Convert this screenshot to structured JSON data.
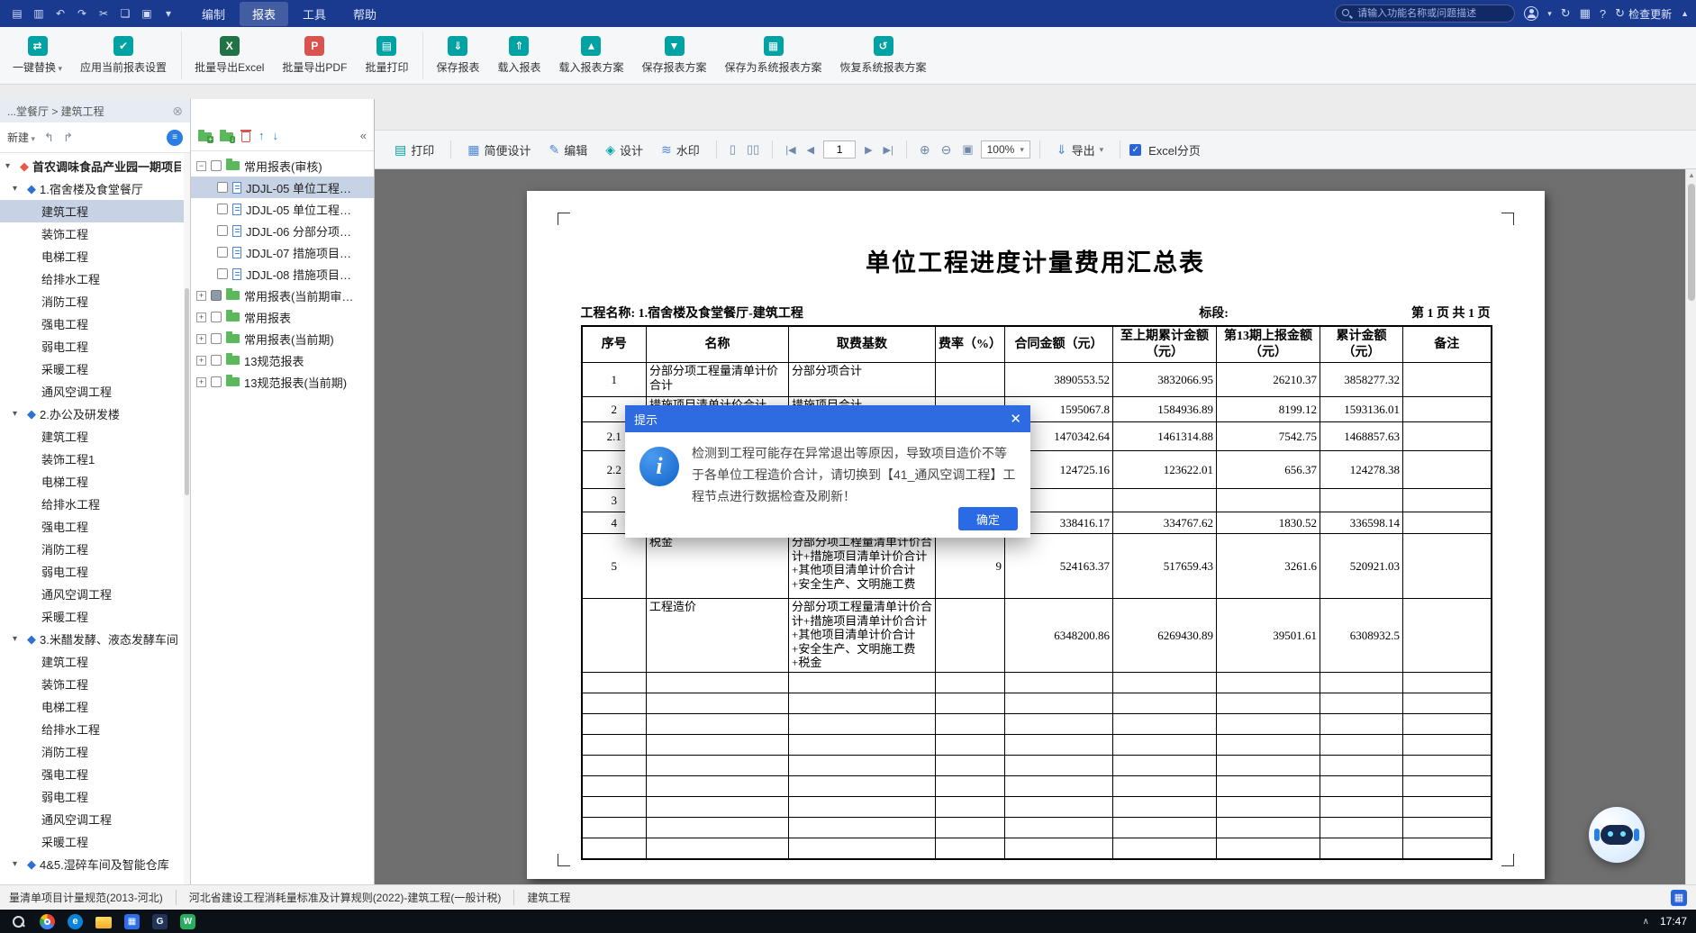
{
  "menubar": {
    "quick_icons": [
      {
        "name": "app-menu-icon",
        "glyph": "▤"
      },
      {
        "name": "save-icon",
        "glyph": "▥"
      },
      {
        "name": "undo-icon",
        "glyph": "↶"
      },
      {
        "name": "redo-icon",
        "glyph": "↷"
      },
      {
        "name": "cut-icon",
        "glyph": "✂"
      },
      {
        "name": "copy-icon",
        "glyph": "❏"
      },
      {
        "name": "paste-icon",
        "glyph": "▣"
      },
      {
        "name": "more-dropdown-icon",
        "glyph": "▾"
      }
    ],
    "menus": [
      {
        "label": "编制"
      },
      {
        "label": "报表",
        "active": true
      },
      {
        "label": "工具"
      },
      {
        "label": "帮助"
      }
    ],
    "search_placeholder": "请输入功能名称或问题描述",
    "check_update_label": "检查更新"
  },
  "ribbon": {
    "buttons": [
      {
        "label": "一键替换",
        "icon": "batch-replace-icon",
        "glyph": "⇄",
        "color": "#00a2a4",
        "dropdown": true
      },
      {
        "label": "应用当前报表设置",
        "icon": "apply-report-settings-icon",
        "glyph": "✔",
        "color": "#00a2a4"
      },
      {
        "label": "批量导出Excel",
        "icon": "batch-export-excel-icon",
        "glyph": "X",
        "color": "#217346",
        "group": "g2"
      },
      {
        "label": "批量导出PDF",
        "icon": "batch-export-pdf-icon",
        "glyph": "P",
        "color": "#d9534f"
      },
      {
        "label": "批量打印",
        "icon": "batch-print-icon",
        "glyph": "▤",
        "color": "#00a2a4"
      },
      {
        "label": "保存报表",
        "icon": "save-report-icon",
        "glyph": "⇓",
        "color": "#00a2a4",
        "group": "g3"
      },
      {
        "label": "载入报表",
        "icon": "load-report-icon",
        "glyph": "⇑",
        "color": "#00a2a4"
      },
      {
        "label": "载入报表方案",
        "icon": "load-report-scheme-icon",
        "glyph": "▲",
        "color": "#00a2a4"
      },
      {
        "label": "保存报表方案",
        "icon": "save-report-scheme-icon",
        "glyph": "▼",
        "color": "#00a2a4"
      },
      {
        "label": "保存为系统报表方案",
        "icon": "save-as-system-scheme-icon",
        "glyph": "▦",
        "color": "#00a2a4"
      },
      {
        "label": "恢复系统报表方案",
        "icon": "restore-system-scheme-icon",
        "glyph": "↺",
        "color": "#00a2a4"
      }
    ]
  },
  "left_panel": {
    "breadcrumb": "...堂餐厅 > 建筑工程",
    "new_button": "新建",
    "tree": [
      {
        "label": "首农调味食品产业园一期项目",
        "level": 0,
        "icon": "project-icon"
      },
      {
        "label": "1.宿舍楼及食堂餐厅",
        "level": 1,
        "icon": "building-icon"
      },
      {
        "label": "建筑工程",
        "level": 2,
        "selected": true
      },
      {
        "label": "装饰工程",
        "level": 2
      },
      {
        "label": "电梯工程",
        "level": 2
      },
      {
        "label": "给排水工程",
        "level": 2
      },
      {
        "label": "消防工程",
        "level": 2
      },
      {
        "label": "强电工程",
        "level": 2
      },
      {
        "label": "弱电工程",
        "level": 2
      },
      {
        "label": "采暖工程",
        "level": 2
      },
      {
        "label": "通风空调工程",
        "level": 2
      },
      {
        "label": "2.办公及研发楼",
        "level": 1,
        "icon": "building-icon"
      },
      {
        "label": "建筑工程",
        "level": 2
      },
      {
        "label": "装饰工程1",
        "level": 2
      },
      {
        "label": "电梯工程",
        "level": 2
      },
      {
        "label": "给排水工程",
        "level": 2
      },
      {
        "label": "强电工程",
        "level": 2
      },
      {
        "label": "消防工程",
        "level": 2
      },
      {
        "label": "弱电工程",
        "level": 2
      },
      {
        "label": "通风空调工程",
        "level": 2
      },
      {
        "label": "采暖工程",
        "level": 2
      },
      {
        "label": "3.米醋发酵、液态发酵车间",
        "level": 1,
        "icon": "building-icon"
      },
      {
        "label": "建筑工程",
        "level": 2
      },
      {
        "label": "装饰工程",
        "level": 2
      },
      {
        "label": "电梯工程",
        "level": 2
      },
      {
        "label": "给排水工程",
        "level": 2
      },
      {
        "label": "消防工程",
        "level": 2
      },
      {
        "label": "强电工程",
        "level": 2
      },
      {
        "label": "弱电工程",
        "level": 2
      },
      {
        "label": "通风空调工程",
        "level": 2
      },
      {
        "label": "采暖工程",
        "level": 2
      },
      {
        "label": "4&5.湿碎车间及智能仓库",
        "level": 1,
        "icon": "building-icon"
      }
    ]
  },
  "middle_panel": {
    "tree": [
      {
        "label": "常用报表(审核)",
        "icon": "folder-icon",
        "checkbox": "empty",
        "expander": "minus"
      },
      {
        "label": "JDJL-05 单位工程…",
        "icon": "report-icon",
        "checkbox": "empty",
        "child": true,
        "selected": true
      },
      {
        "label": "JDJL-05 单位工程…",
        "icon": "report-icon",
        "checkbox": "empty",
        "child": true
      },
      {
        "label": "JDJL-06 分部分项…",
        "icon": "report-icon",
        "checkbox": "empty",
        "child": true
      },
      {
        "label": "JDJL-07 措施项目…",
        "icon": "report-icon",
        "checkbox": "empty",
        "child": true
      },
      {
        "label": "JDJL-08 措施项目…",
        "icon": "report-icon",
        "checkbox": "empty",
        "child": true
      },
      {
        "label": "常用报表(当前期审…",
        "icon": "folder-icon",
        "checkbox": "filled",
        "expander": "plus"
      },
      {
        "label": "常用报表",
        "icon": "folder-icon",
        "checkbox": "empty",
        "expander": "plus"
      },
      {
        "label": "常用报表(当前期)",
        "icon": "folder-icon",
        "checkbox": "empty",
        "expander": "plus"
      },
      {
        "label": "13规范报表",
        "icon": "folder-icon",
        "checkbox": "empty",
        "expander": "plus"
      },
      {
        "label": "13规范报表(当前期)",
        "icon": "folder-icon",
        "checkbox": "empty",
        "expander": "plus"
      }
    ]
  },
  "preview": {
    "print": "打印",
    "simple_design": "简便设计",
    "edit": "编辑",
    "design": "设计",
    "watermark": "水印",
    "page_value": "1",
    "zoom_value": "100%",
    "export": "导出",
    "excel_paging": "Excel分页"
  },
  "report": {
    "title": "单位工程进度计量费用汇总表",
    "project_label": "工程名称: 1.宿舍楼及食堂餐厅-建筑工程",
    "section_label": "标段:",
    "page_label": "第 1 页 共 1 页",
    "columns": [
      "序号",
      "名称",
      "取费基数",
      "费率（%）",
      "合同金额（元）",
      "至上期累计金额（元）",
      "第13期上报金额（元）",
      "累计金额（元）",
      "备注"
    ],
    "rows": [
      {
        "xh": "1",
        "mc": "分部分项工程量清单计价合计",
        "qf": "分部分项合计",
        "fl": "",
        "ht": "3890553.52",
        "sq": "3832066.95",
        "bq": "26210.37",
        "lj": "3858277.32",
        "bz": ""
      },
      {
        "xh": "2",
        "mc": "措施项目清单计价合计",
        "qf": "措施项目合计",
        "fl": "",
        "ht": "1595067.8",
        "sq": "1584936.89",
        "bq": "8199.12",
        "lj": "1593136.01",
        "bz": ""
      },
      {
        "xh": "2.1",
        "mc": "",
        "qf": "",
        "fl": "",
        "ht": "1470342.64",
        "sq": "1461314.88",
        "bq": "7542.75",
        "lj": "1468857.63",
        "bz": ""
      },
      {
        "xh": "2.2",
        "mc": "",
        "qf": "",
        "fl": "",
        "ht": "124725.16",
        "sq": "123622.01",
        "bq": "656.37",
        "lj": "124278.38",
        "bz": ""
      },
      {
        "xh": "3",
        "mc": "",
        "qf": "",
        "fl": "",
        "ht": "",
        "sq": "",
        "bq": "",
        "lj": "",
        "bz": ""
      },
      {
        "xh": "4",
        "mc": "",
        "qf": "",
        "fl": "",
        "ht": "338416.17",
        "sq": "334767.62",
        "bq": "1830.52",
        "lj": "336598.14",
        "bz": ""
      },
      {
        "xh": "5",
        "mc": "税金",
        "qf": "分部分项工程量清单计价合计+措施项目清单计价合计+其他项目清单计价合计+安全生产、文明施工费",
        "fl": "9",
        "ht": "524163.37",
        "sq": "517659.43",
        "bq": "3261.6",
        "lj": "520921.03",
        "bz": ""
      },
      {
        "xh": "",
        "mc": "工程造价",
        "qf": "分部分项工程量清单计价合计+措施项目清单计价合计+其他项目清单计价合计+安全生产、文明施工费+税金",
        "fl": "",
        "ht": "6348200.86",
        "sq": "6269430.89",
        "bq": "39501.61",
        "lj": "6308932.5",
        "bz": ""
      },
      {
        "xh": "",
        "mc": "",
        "qf": "",
        "fl": "",
        "ht": "",
        "sq": "",
        "bq": "",
        "lj": "",
        "bz": ""
      },
      {
        "xh": "",
        "mc": "",
        "qf": "",
        "fl": "",
        "ht": "",
        "sq": "",
        "bq": "",
        "lj": "",
        "bz": ""
      },
      {
        "xh": "",
        "mc": "",
        "qf": "",
        "fl": "",
        "ht": "",
        "sq": "",
        "bq": "",
        "lj": "",
        "bz": ""
      },
      {
        "xh": "",
        "mc": "",
        "qf": "",
        "fl": "",
        "ht": "",
        "sq": "",
        "bq": "",
        "lj": "",
        "bz": ""
      },
      {
        "xh": "",
        "mc": "",
        "qf": "",
        "fl": "",
        "ht": "",
        "sq": "",
        "bq": "",
        "lj": "",
        "bz": ""
      },
      {
        "xh": "",
        "mc": "",
        "qf": "",
        "fl": "",
        "ht": "",
        "sq": "",
        "bq": "",
        "lj": "",
        "bz": ""
      },
      {
        "xh": "",
        "mc": "",
        "qf": "",
        "fl": "",
        "ht": "",
        "sq": "",
        "bq": "",
        "lj": "",
        "bz": ""
      },
      {
        "xh": "",
        "mc": "",
        "qf": "",
        "fl": "",
        "ht": "",
        "sq": "",
        "bq": "",
        "lj": "",
        "bz": ""
      },
      {
        "xh": "",
        "mc": "",
        "qf": "",
        "fl": "",
        "ht": "",
        "sq": "",
        "bq": "",
        "lj": "",
        "bz": ""
      }
    ]
  },
  "dialog": {
    "title": "提示",
    "message": "检测到工程可能存在异常退出等原因，导致项目造价不等于各单位工程造价合计，请切换到【41_通风空调工程】工程节点进行数据检查及刷新！",
    "ok_label": "确定"
  },
  "statusbar": {
    "items": [
      "量清单项目计量规范(2013-河北)",
      "河北省建设工程消耗量标准及计算规则(2022)-建筑工程(一般计税)",
      "建筑工程"
    ]
  },
  "taskbar": {
    "time": "17:47",
    "icons": [
      {
        "name": "search-icon",
        "glyph": ""
      },
      {
        "name": "chrome-icon",
        "glyph": ""
      },
      {
        "name": "edge-icon",
        "glyph": "e"
      },
      {
        "name": "file-explorer-icon",
        "glyph": ""
      },
      {
        "name": "app-grid-icon",
        "glyph": "▦"
      },
      {
        "name": "glodon-icon",
        "glyph": "G"
      },
      {
        "name": "wechat-icon",
        "glyph": "W"
      }
    ]
  }
}
